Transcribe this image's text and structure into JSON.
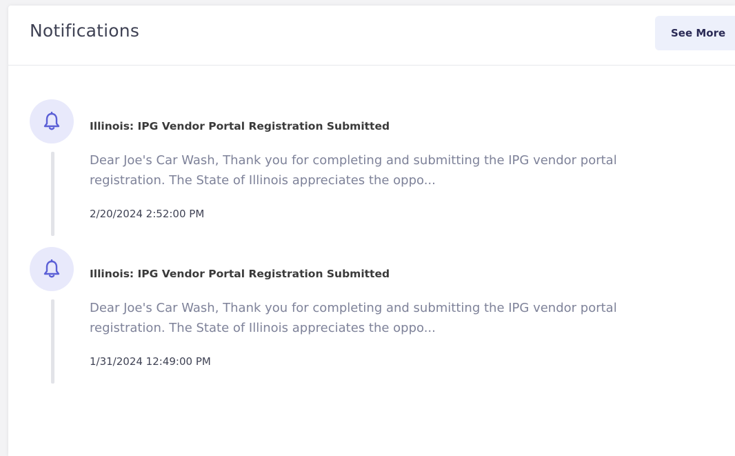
{
  "header": {
    "title": "Notifications",
    "see_more_label": "See More"
  },
  "notifications": [
    {
      "icon": "bell-icon",
      "title": "Illinois: IPG Vendor Portal Registration Submitted",
      "body": "Dear Joe's Car Wash, Thank you for completing and submitting the IPG vendor portal registration. The State of Illinois appreciates the oppo...",
      "date": "2/20/2024 2:52:00 PM"
    },
    {
      "icon": "bell-icon",
      "title": "Illinois: IPG Vendor Portal Registration Submitted",
      "body": "Dear Joe's Car Wash, Thank you for completing and submitting the IPG vendor portal registration. The State of Illinois appreciates the oppo...",
      "date": "1/31/2024 12:49:00 PM"
    }
  ],
  "colors": {
    "accent": "#5b5fd6",
    "icon_bg": "#e8e9fb",
    "timeline_line": "#e2e3e8"
  }
}
